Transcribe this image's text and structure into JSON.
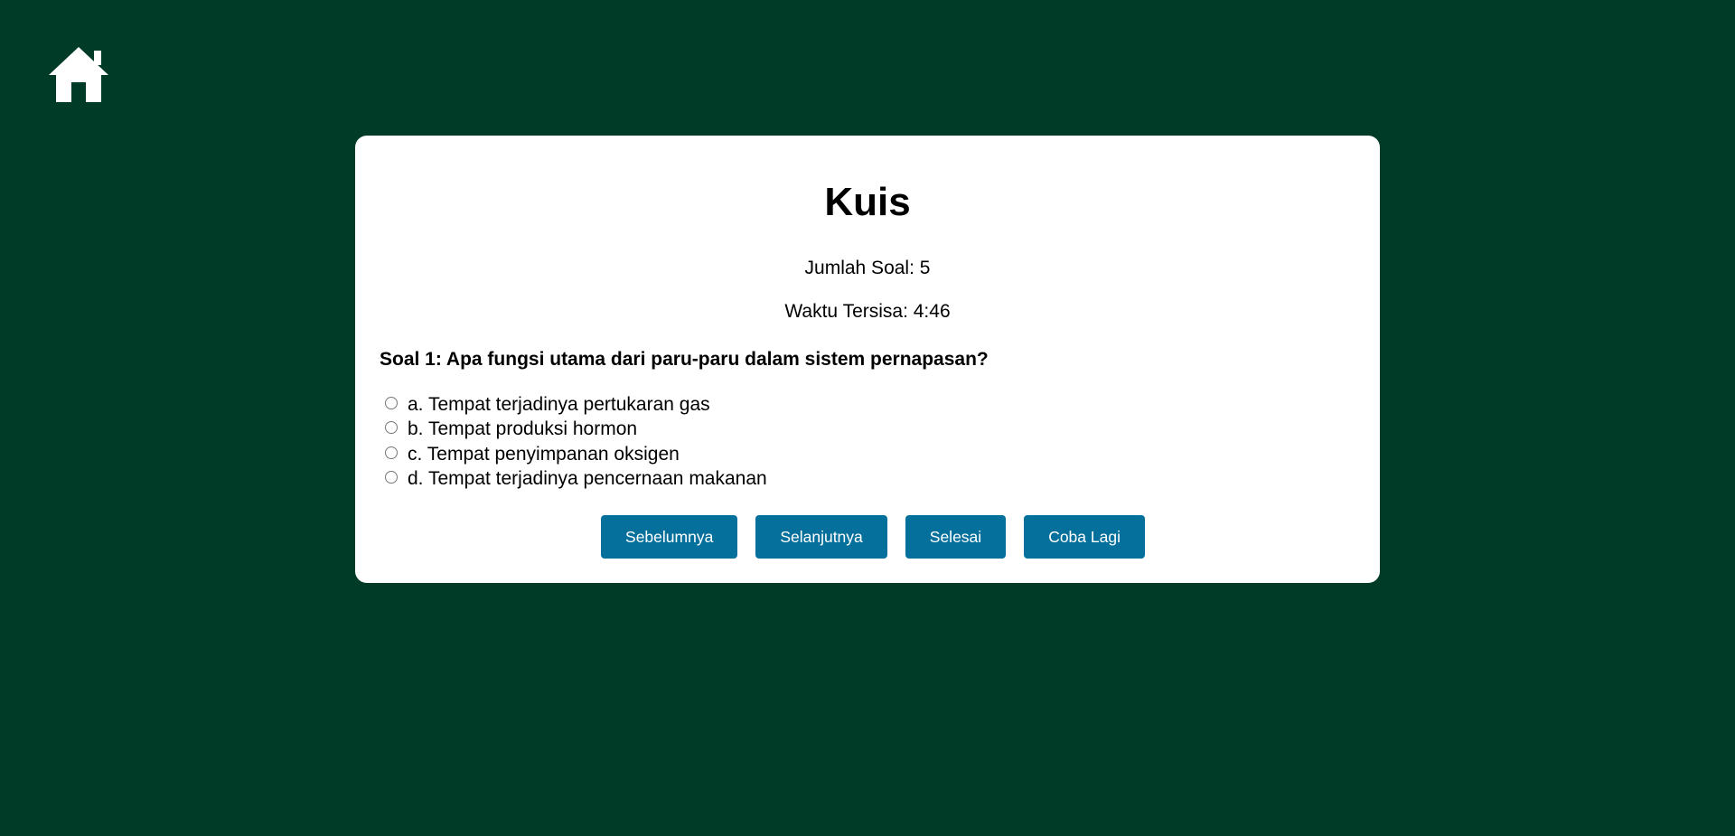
{
  "home": {
    "icon": "home-icon"
  },
  "quiz": {
    "title": "Kuis",
    "question_count": "Jumlah Soal: 5",
    "time_left": "Waktu Tersisa: 4:46",
    "question": "Soal 1: Apa fungsi utama dari paru-paru dalam sistem pernapasan?",
    "options": [
      {
        "label": "a. Tempat terjadinya pertukaran gas",
        "selected": false
      },
      {
        "label": "b. Tempat produksi hormon",
        "selected": false
      },
      {
        "label": "c. Tempat penyimpanan oksigen",
        "selected": false
      },
      {
        "label": "d. Tempat terjadinya pencernaan makanan",
        "selected": false
      }
    ],
    "buttons": {
      "previous": "Sebelumnya",
      "next": "Selanjutnya",
      "finish": "Selesai",
      "retry": "Coba Lagi"
    }
  },
  "colors": {
    "background": "#003b27",
    "card": "#ffffff",
    "button": "#06709c",
    "button_text": "#ffffff"
  }
}
